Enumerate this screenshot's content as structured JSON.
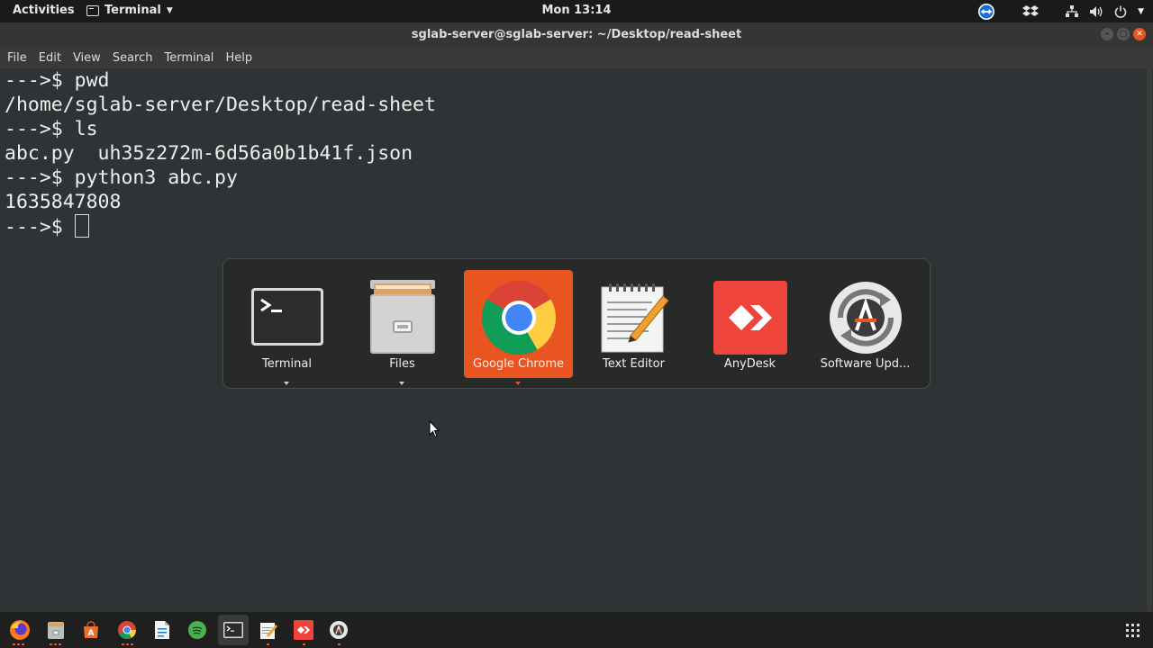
{
  "topbar": {
    "activities": "Activities",
    "app_menu": "Terminal",
    "clock": "Mon 13:14"
  },
  "window": {
    "title": "sglab-server@sglab-server: ~/Desktop/read-sheet",
    "menu": [
      "File",
      "Edit",
      "View",
      "Search",
      "Terminal",
      "Help"
    ]
  },
  "terminal": {
    "lines": [
      "--->$ pwd",
      "/home/sglab-server/Desktop/read-sheet",
      "--->$ ls",
      "abc.py  uh35z272m-6d56a0b1b41f.json",
      "--->$ python3 abc.py",
      "1635847808"
    ],
    "prompt": "--->$ "
  },
  "switcher": {
    "selected": "Google Chrome",
    "apps": [
      {
        "label": "Terminal",
        "icon": "terminal-icon"
      },
      {
        "label": "Files",
        "icon": "files-icon"
      },
      {
        "label": "Google Chrome",
        "icon": "chrome-icon"
      },
      {
        "label": "Text Editor",
        "icon": "text-editor-icon"
      },
      {
        "label": "AnyDesk",
        "icon": "anydesk-icon"
      },
      {
        "label": "Software Upd...",
        "icon": "software-updater-icon"
      }
    ]
  },
  "dock": {
    "apps": [
      "firefox-icon",
      "files-icon",
      "software-center-icon",
      "chrome-icon",
      "libreoffice-writer-icon",
      "spotify-icon",
      "terminal-icon",
      "text-editor-icon",
      "anydesk-icon",
      "software-updater-icon"
    ],
    "show_apps": "show-applications-icon"
  },
  "colors": {
    "accent": "#e95420",
    "terminal_bg": "#2e3436",
    "anydesk": "#ef443b"
  }
}
